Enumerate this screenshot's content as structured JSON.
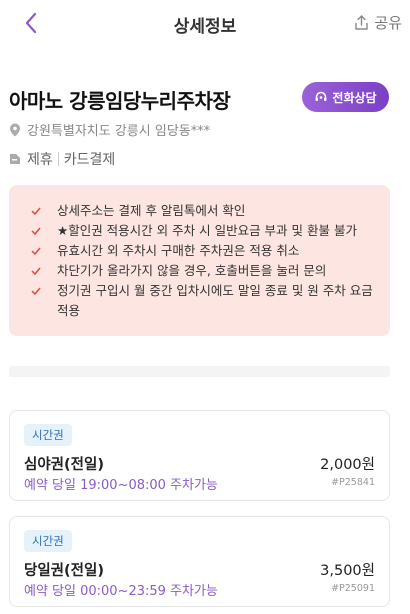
{
  "header": {
    "title": "상세정보",
    "share_label": "공유"
  },
  "place": {
    "name": "아마노 강릉임당누리주차장",
    "call_button": "전화상담",
    "address": "강원특별자치도 강릉시 임당동***",
    "tags": [
      "제휴",
      "카드결제"
    ]
  },
  "notice": {
    "items": [
      "상세주소는 결제 후 알림톡에서 확인",
      "★할인권 적용시간 외 주차 시 일반요금 부과 및 환불 불가",
      "유효시간 외 주차시 구매한 주차권은 적용 취소",
      "차단기가 올라가지 않을 경우, 호출버튼을 눌러 문의",
      "정기권 구입시 월 중간 입차시에도 말일 종료 및 원 주차 요금 적용"
    ]
  },
  "tickets": [
    {
      "badge": "시간권",
      "name": "심야권(전일)",
      "price": "2,000원",
      "time": "예약 당일 19:00~08:00 주차가능",
      "code": "#P25841"
    },
    {
      "badge": "시간권",
      "name": "당일권(전일)",
      "price": "3,500원",
      "time": "예약 당일 00:00~23:59 주차가능",
      "code": "#P25091"
    }
  ],
  "colors": {
    "accent": "#8a4fd0",
    "notice_bg": "#fde5e2",
    "check": "#e0483a",
    "badge_bg": "#e5f1fb",
    "badge_text": "#2d72b8"
  }
}
